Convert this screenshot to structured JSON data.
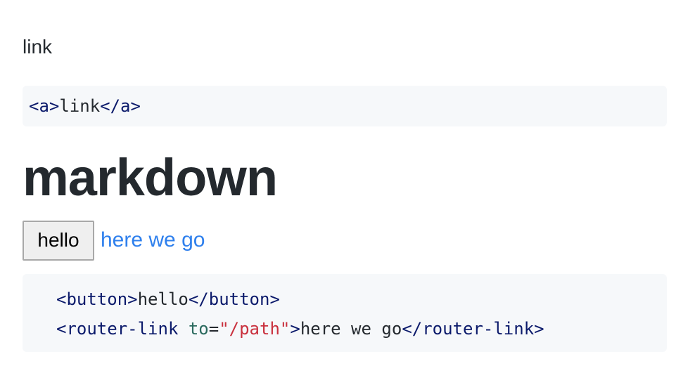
{
  "intro": {
    "text": "link"
  },
  "code_example_1": {
    "open_tag": "<a>",
    "content": "link",
    "close_tag": "</a>"
  },
  "section": {
    "heading": "markdown"
  },
  "demo": {
    "button_label": "hello",
    "link_label": "here we go"
  },
  "code_example_2": {
    "line1": {
      "open_tag": "<button>",
      "content": "hello",
      "close_tag": "</button>"
    },
    "line2": {
      "open_tag_start": "<router-link ",
      "attr_name": "to",
      "equals": "=",
      "attr_value": "\"/path\"",
      "open_tag_end": ">",
      "content": "here we go",
      "close_tag": "</router-link>"
    }
  },
  "colors": {
    "code_background": "#f6f8fa",
    "tag": "#0b1a6b",
    "attribute": "#2a6a5e",
    "string": "#c9303d",
    "link": "#2f80ed",
    "text": "#24292e"
  }
}
